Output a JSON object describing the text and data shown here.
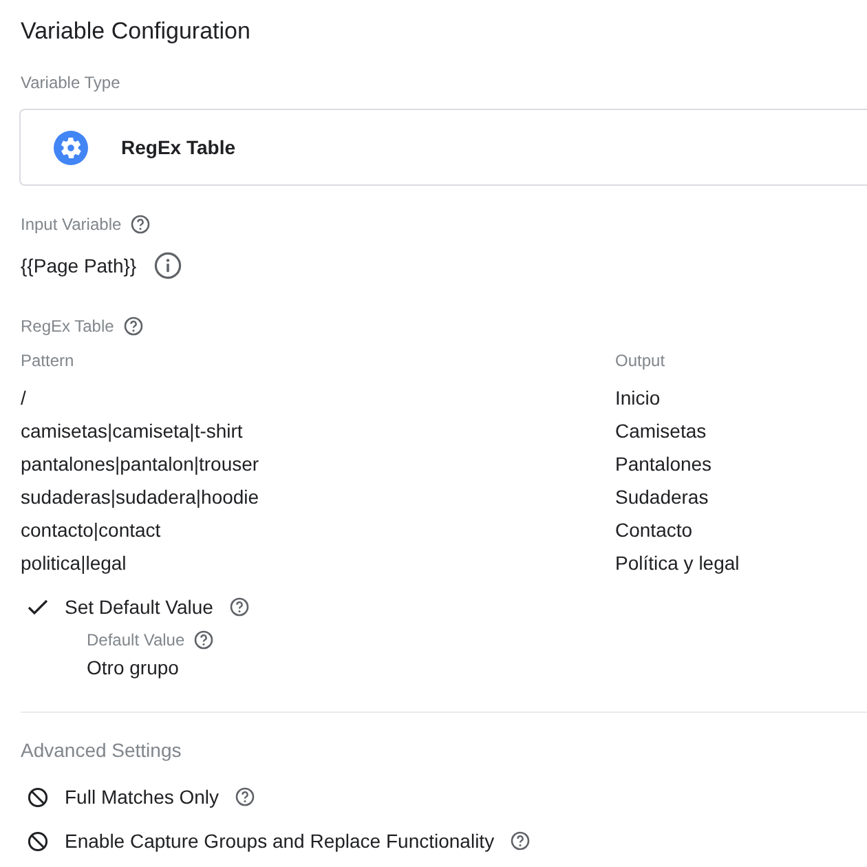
{
  "title": "Variable Configuration",
  "variable_type": {
    "label": "Variable Type",
    "value": "RegEx Table"
  },
  "input_variable": {
    "label": "Input Variable",
    "value": "{{Page Path}}"
  },
  "regex_table": {
    "label": "RegEx Table",
    "columns": [
      "Pattern",
      "Output"
    ],
    "rows": [
      [
        "/",
        "Inicio"
      ],
      [
        "camisetas|camiseta|t-shirt",
        "Camisetas"
      ],
      [
        "pantalones|pantalon|trouser",
        "Pantalones"
      ],
      [
        "sudaderas|sudadera|hoodie",
        "Sudaderas"
      ],
      [
        "contacto|contact",
        "Contacto"
      ],
      [
        "politica|legal",
        "Política y legal"
      ]
    ]
  },
  "default_setting": {
    "label": "Set Default Value",
    "enabled": true,
    "value_label": "Default Value",
    "value": "Otro grupo"
  },
  "advanced_settings": {
    "title": "Advanced Settings",
    "options": [
      {
        "label": "Full Matches Only",
        "enabled": false
      },
      {
        "label": "Enable Capture Groups and Replace Functionality",
        "enabled": false
      }
    ]
  }
}
